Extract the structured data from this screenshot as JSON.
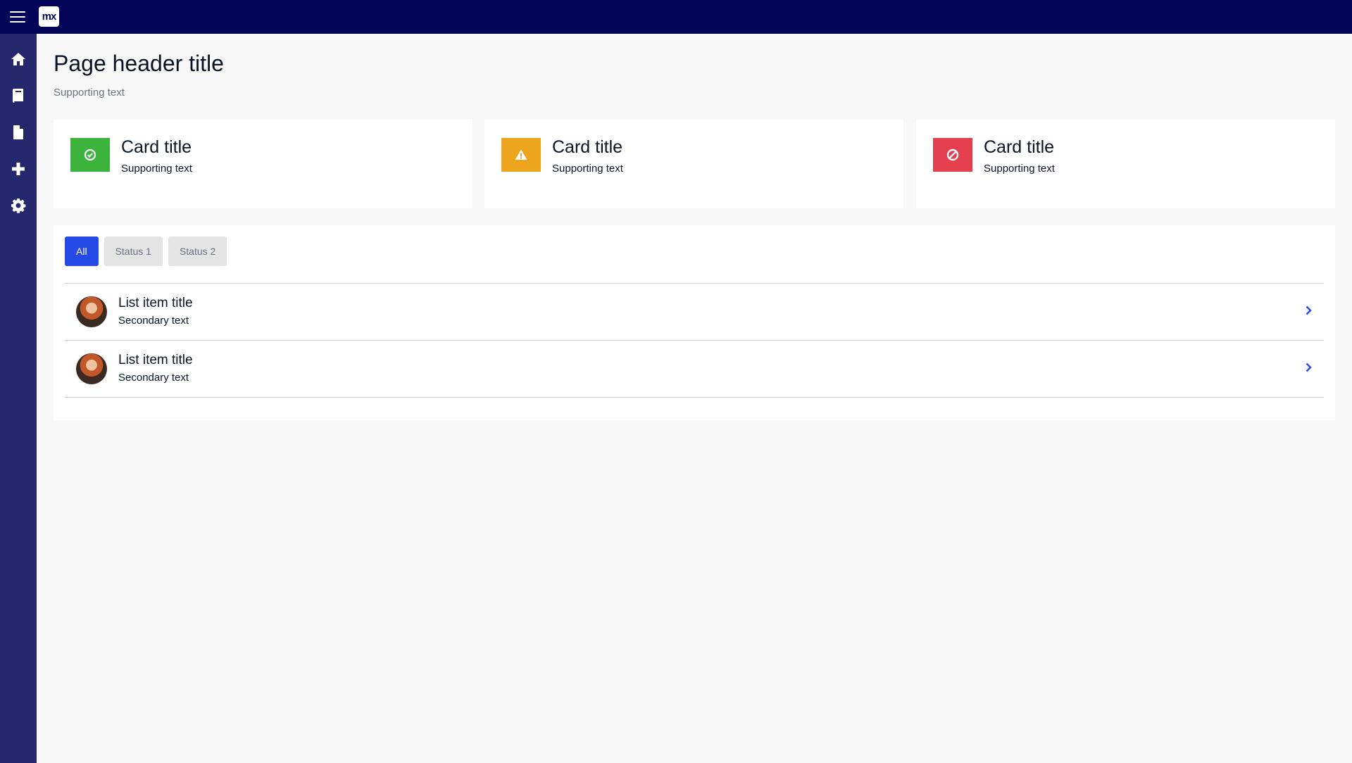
{
  "topbar": {
    "menu_icon": "hamburger-menu-icon",
    "logo_text": "mx",
    "background": "#020557"
  },
  "sidebar": {
    "background": "#24276c",
    "items": [
      {
        "icon": "home-icon"
      },
      {
        "icon": "book-icon"
      },
      {
        "icon": "file-icon"
      },
      {
        "icon": "plus-icon"
      },
      {
        "icon": "gear-icon"
      }
    ]
  },
  "header": {
    "title": "Page header title",
    "subtitle": "Supporting text"
  },
  "cards": [
    {
      "title": "Card title",
      "subtitle": "Supporting text",
      "icon": "check-circle-icon",
      "color": "#3cb33d"
    },
    {
      "title": "Card title",
      "subtitle": "Supporting text",
      "icon": "warning-triangle-icon",
      "color": "#eca51c"
    },
    {
      "title": "Card title",
      "subtitle": "Supporting text",
      "icon": "ban-icon",
      "color": "#e33f4e"
    }
  ],
  "filter_tabs": [
    {
      "label": "All",
      "active": true
    },
    {
      "label": "Status 1",
      "active": false
    },
    {
      "label": "Status 2",
      "active": false
    }
  ],
  "list": [
    {
      "title": "List item title",
      "secondary": "Secondary text",
      "icon": "chevron-right-icon"
    },
    {
      "title": "List item title",
      "secondary": "Secondary text",
      "icon": "chevron-right-icon"
    }
  ],
  "colors": {
    "accent": "#264ae5",
    "page_background": "#f8f8f8"
  }
}
